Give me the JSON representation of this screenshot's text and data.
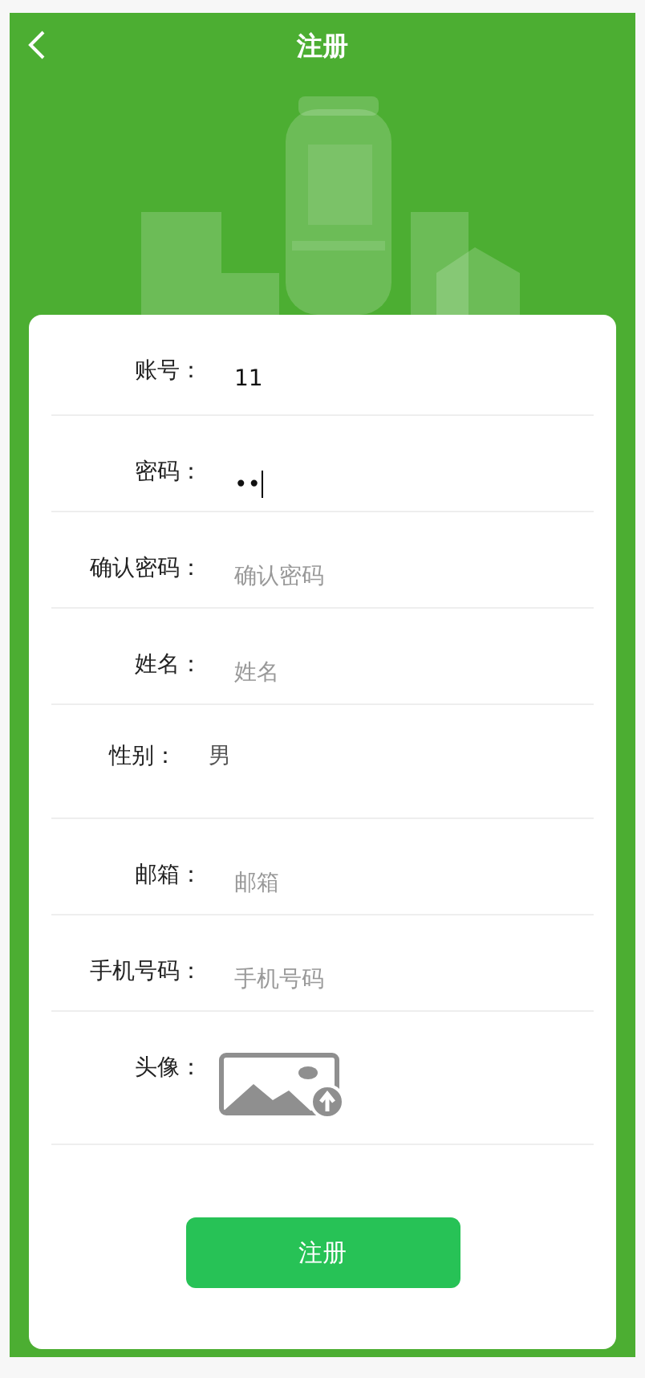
{
  "header": {
    "title": "注册"
  },
  "fields": [
    {
      "kind": "input",
      "label": "账号：",
      "value": "11"
    },
    {
      "kind": "input",
      "label": "密码：",
      "value": "••",
      "focused": true
    },
    {
      "kind": "input",
      "label": "确认密码：",
      "placeholder": "确认密码"
    },
    {
      "kind": "input",
      "label": "姓名：",
      "placeholder": "姓名"
    },
    {
      "kind": "static",
      "label": "性别：",
      "value": "男"
    },
    {
      "kind": "input",
      "label": "邮箱：",
      "placeholder": "邮箱"
    },
    {
      "kind": "input",
      "label": "手机号码：",
      "placeholder": "手机号码"
    },
    {
      "kind": "upload",
      "label": "头像："
    }
  ],
  "submit_button": "注册"
}
